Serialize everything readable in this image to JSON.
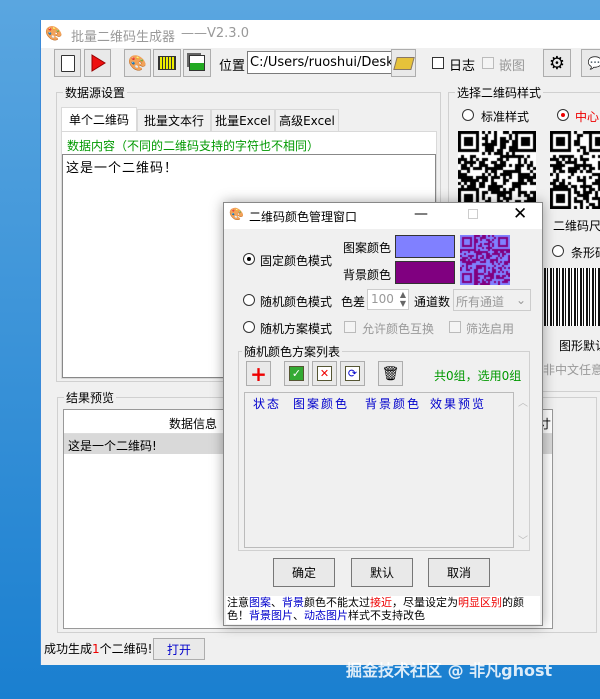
{
  "app": {
    "title": "批量二维码生成器",
    "version": "——V2.3.0"
  },
  "toolbar": {
    "location_label": "位置",
    "path_value": "C:/Users/ruoshui/Desktc",
    "log_label": "日志",
    "embed_label": "嵌图"
  },
  "datasource": {
    "group_label": "数据源设置",
    "tabs": [
      {
        "label": "单个二维码"
      },
      {
        "label": "批量文本行"
      },
      {
        "label": "批量Excel"
      },
      {
        "label": "高级Excel"
      }
    ],
    "hint": "数据内容（不同的二维码支持的字符也不相同）",
    "content": "这是一个二维码！"
  },
  "style": {
    "group_label": "选择二维码样式",
    "standard": "标准样式",
    "center": "中心",
    "size_label": "二维码尺",
    "barcode": "条形码",
    "graphic_default": "图形默认",
    "any_char": "非中文任意字"
  },
  "results": {
    "group_label": "结果预览",
    "column": "数据信息",
    "column2": "寸",
    "rows": [
      {
        "data": "这是一个二维码!"
      }
    ]
  },
  "status": {
    "prefix": "成功生成",
    "count": "1",
    "suffix": "个二维码!",
    "open_button": "打开"
  },
  "dialog": {
    "title": "二维码颜色管理窗口",
    "fixed_mode": "固定颜色模式",
    "pattern_color_label": "图案颜色",
    "bg_color_label": "背景颜色",
    "pattern_color": "#8080ff",
    "bg_color": "#800080",
    "random_mode": "随机颜色模式",
    "diff_label": "色差",
    "diff_value": "100",
    "channel_label": "通道数",
    "channel_value": "所有通道",
    "scheme_mode": "随机方案模式",
    "allow_swap": "允许颜色互换",
    "filter_enable": "筛选启用",
    "list_group": "随机颜色方案列表",
    "count_text": "共0组，选用0组",
    "columns": [
      "状态",
      "图案颜色",
      "背景颜色",
      "效果预览"
    ],
    "ok": "确定",
    "default": "默认",
    "cancel": "取消",
    "note": [
      {
        "t": "注意",
        "c": "k"
      },
      {
        "t": "图案",
        "c": "b"
      },
      {
        "t": "、",
        "c": "k"
      },
      {
        "t": "背景",
        "c": "b"
      },
      {
        "t": "颜色不能太过",
        "c": "k"
      },
      {
        "t": "接近",
        "c": "r"
      },
      {
        "t": "，尽量设定为",
        "c": "k"
      },
      {
        "t": "明显区别",
        "c": "r"
      },
      {
        "t": "的颜色！",
        "c": "k"
      },
      {
        "t": "背景图片",
        "c": "b"
      },
      {
        "t": "、",
        "c": "k"
      },
      {
        "t": "动态图片",
        "c": "b"
      },
      {
        "t": "样式不支持改色",
        "c": "k"
      }
    ]
  },
  "watermark": "掘金技术社区 @ 非凡ghost"
}
